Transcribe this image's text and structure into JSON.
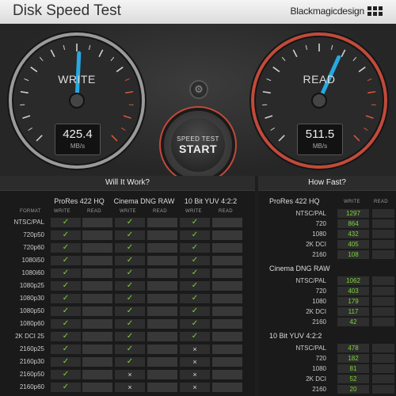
{
  "titlebar": {
    "title": "Disk Speed Test",
    "brand": "Blackmagicdesign"
  },
  "write_gauge": {
    "label": "WRITE",
    "value": "425.4",
    "unit": "MB/s",
    "fraction": 0.51
  },
  "read_gauge": {
    "label": "READ",
    "value": "511.5",
    "unit": "MB/s",
    "fraction": 0.59
  },
  "start": {
    "top": "SPEED TEST",
    "bottom": "START"
  },
  "will_it_work": {
    "title": "Will It Work?",
    "format_label": "FORMAT",
    "write_label": "WRITE",
    "read_label": "READ",
    "codecs": [
      "ProRes 422 HQ",
      "Cinema DNG RAW",
      "10 Bit YUV 4:2:2"
    ],
    "rows": [
      {
        "format": "NTSC/PAL",
        "w": [
          "y",
          "y",
          "y"
        ]
      },
      {
        "format": "720p50",
        "w": [
          "y",
          "y",
          "y"
        ]
      },
      {
        "format": "720p60",
        "w": [
          "y",
          "y",
          "y"
        ]
      },
      {
        "format": "1080i50",
        "w": [
          "y",
          "y",
          "y"
        ]
      },
      {
        "format": "1080i60",
        "w": [
          "y",
          "y",
          "y"
        ]
      },
      {
        "format": "1080p25",
        "w": [
          "y",
          "y",
          "y"
        ]
      },
      {
        "format": "1080p30",
        "w": [
          "y",
          "y",
          "y"
        ]
      },
      {
        "format": "1080p50",
        "w": [
          "y",
          "y",
          "y"
        ]
      },
      {
        "format": "1080p60",
        "w": [
          "y",
          "y",
          "y"
        ]
      },
      {
        "format": "2K DCI 25",
        "w": [
          "y",
          "y",
          "y"
        ]
      },
      {
        "format": "2160p25",
        "w": [
          "y",
          "y",
          "n"
        ]
      },
      {
        "format": "2160p30",
        "w": [
          "y",
          "y",
          "n"
        ]
      },
      {
        "format": "2160p50",
        "w": [
          "y",
          "n",
          "n"
        ]
      },
      {
        "format": "2160p60",
        "w": [
          "y",
          "n",
          "n"
        ]
      }
    ],
    "check_glyph": "✓",
    "cross_glyph": "×"
  },
  "how_fast": {
    "title": "How Fast?",
    "write_label": "WRITE",
    "read_label": "READ",
    "sections": [
      {
        "name": "ProRes 422 HQ",
        "rows": [
          {
            "label": "NTSC/PAL",
            "write": "1297"
          },
          {
            "label": "720",
            "write": "864"
          },
          {
            "label": "1080",
            "write": "432"
          },
          {
            "label": "2K DCI",
            "write": "405"
          },
          {
            "label": "2160",
            "write": "108"
          }
        ]
      },
      {
        "name": "Cinema DNG RAW",
        "rows": [
          {
            "label": "NTSC/PAL",
            "write": "1062"
          },
          {
            "label": "720",
            "write": "403"
          },
          {
            "label": "1080",
            "write": "179"
          },
          {
            "label": "2K DCI",
            "write": "117"
          },
          {
            "label": "2160",
            "write": "42"
          }
        ]
      },
      {
        "name": "10 Bit YUV 4:2:2",
        "rows": [
          {
            "label": "NTSC/PAL",
            "write": "478"
          },
          {
            "label": "720",
            "write": "182"
          },
          {
            "label": "1080",
            "write": "81"
          },
          {
            "label": "2K DCI",
            "write": "52"
          },
          {
            "label": "2160",
            "write": "20"
          }
        ]
      }
    ]
  },
  "colors": {
    "check": "#7fd53a",
    "needle": "#27a8e0",
    "read_ring": "#c24a3a"
  }
}
